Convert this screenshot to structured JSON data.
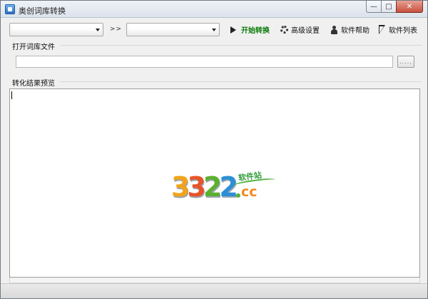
{
  "window": {
    "title": "奥创词库转换"
  },
  "window_controls": {
    "minimize": "—",
    "maximize": "□",
    "close": "✕"
  },
  "toolbar": {
    "source_select": {
      "value": ""
    },
    "separator": ">>",
    "target_select": {
      "value": ""
    },
    "start_label": "开始转换",
    "advanced_label": "高级设置",
    "help_label": "软件帮助",
    "list_label": "软件列表"
  },
  "open_file": {
    "label": "打开词库文件",
    "path_value": "",
    "browse_label": "....."
  },
  "preview": {
    "label": "转化结果预览",
    "content": ""
  },
  "watermark": {
    "digits": [
      "3",
      "3",
      "2",
      "2"
    ],
    "suffix": "cc",
    "tag": "软件站"
  },
  "colors": {
    "start_green": "#0a7a0a",
    "close_red": "#c6513d",
    "wm_orange": "#f08a1e",
    "wm_green": "#5cb030",
    "wm_blue": "#2c8fd6"
  },
  "icons": {
    "start": "play-icon",
    "advanced": "gear-icon",
    "help": "person-icon",
    "list": "cursor-icon"
  }
}
